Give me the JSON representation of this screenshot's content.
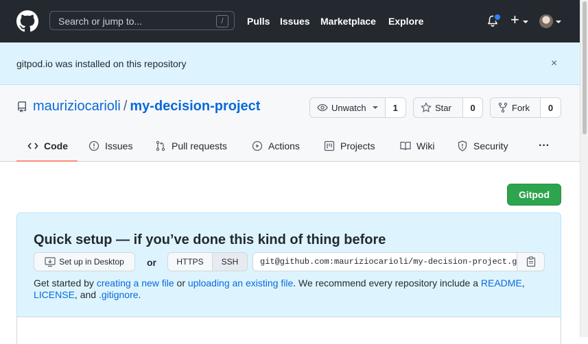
{
  "header": {
    "search_placeholder": "Search or jump to...",
    "search_shortcut": "/",
    "nav": [
      "Pulls",
      "Issues",
      "Marketplace",
      "Explore"
    ],
    "plus_label": "+"
  },
  "flash": {
    "message": "gitpod.io was installed on this repository",
    "close": "×"
  },
  "repo": {
    "owner": "mauriziocarioli",
    "separator": "/",
    "name": "my-decision-project",
    "watch_label": "Unwatch",
    "watch_count": "1",
    "star_label": "Star",
    "star_count": "0",
    "fork_label": "Fork",
    "fork_count": "0"
  },
  "tabs": [
    {
      "label": "Code"
    },
    {
      "label": "Issues"
    },
    {
      "label": "Pull requests"
    },
    {
      "label": "Actions"
    },
    {
      "label": "Projects"
    },
    {
      "label": "Wiki"
    },
    {
      "label": "Security"
    }
  ],
  "more_label": "···",
  "gitpod_label": "Gitpod",
  "quick_setup": {
    "title": "Quick setup — if you’ve done this kind of thing before",
    "desktop_label": "Set up in Desktop",
    "or": "or",
    "https_label": "HTTPS",
    "ssh_label": "SSH",
    "clone_url": "git@github.com:mauriziocarioli/my-decision-project.git",
    "text_1": "Get started by ",
    "link_create": "creating a new file",
    "text_2": " or ",
    "link_upload": "uploading an existing file",
    "text_3": ". We recommend every repository include a ",
    "link_readme": "README",
    "text_4": ", ",
    "link_license": "LICENSE",
    "text_5": ", and ",
    "link_gitignore": ".gitignore",
    "text_6": "."
  },
  "colors": {
    "header_bg": "#24292f",
    "flash_bg": "#ddf4ff",
    "link": "#0969da",
    "gitpod_green": "#2da44e",
    "tab_underline": "#fd8c73"
  }
}
